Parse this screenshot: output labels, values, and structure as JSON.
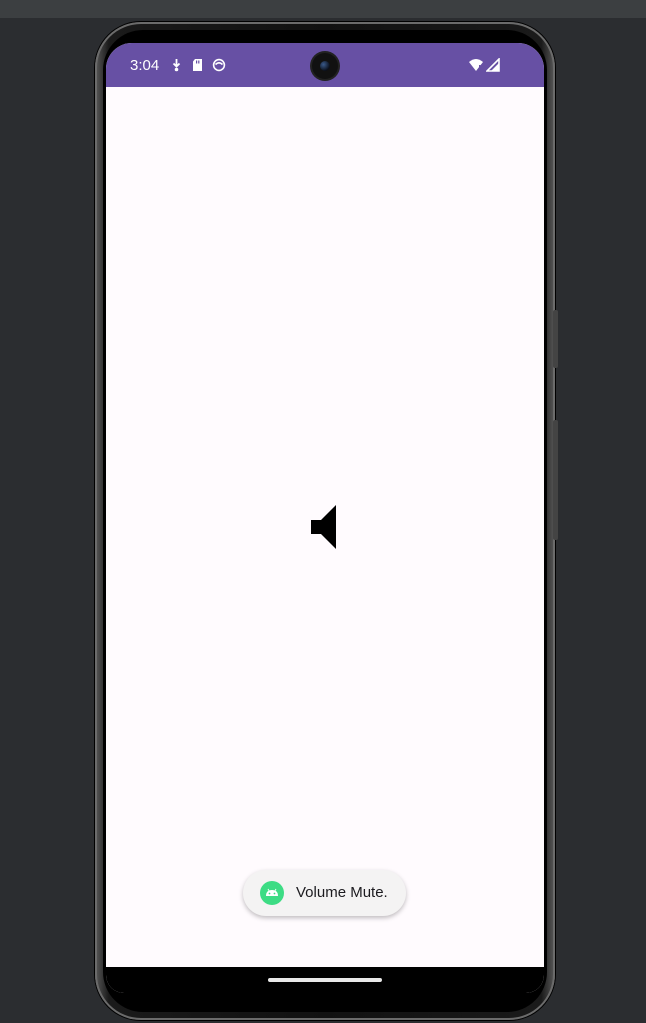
{
  "status_bar": {
    "time": "3:04",
    "left_icons": [
      "download-icon",
      "sd-card-icon",
      "sync-icon"
    ],
    "right_icons": [
      "wifi-icon",
      "cell-signal-icon"
    ],
    "color": "#6750a4"
  },
  "main": {
    "center_icon": "volume-mute-icon",
    "background": "#fffbfe"
  },
  "toast": {
    "icon": "android-icon",
    "message": "Volume Mute."
  },
  "nav_bar": {
    "handle": "home-gesture-handle"
  }
}
